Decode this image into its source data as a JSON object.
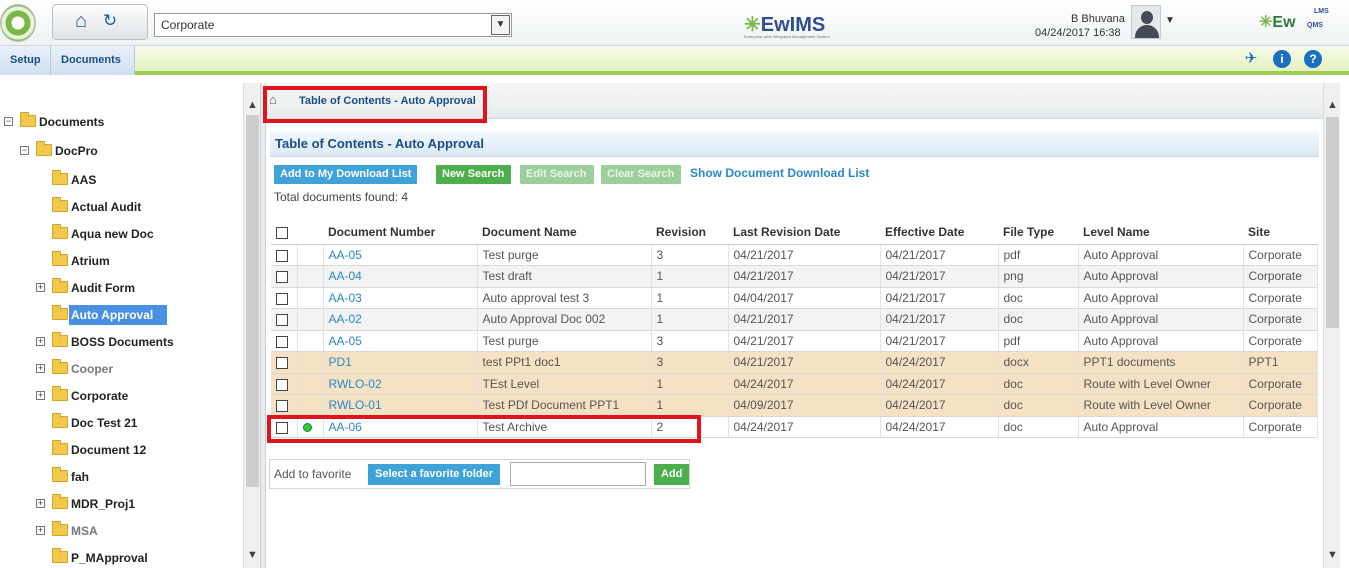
{
  "header": {
    "site_select": "Corporate",
    "brand_center": "EwIMS",
    "brand_center_tag": "Enterprise-wide Integrated Management System",
    "user_name": "B Bhuvana",
    "user_datetime": "04/24/2017 16:38",
    "brand_right": "Ew",
    "brand_right_lms": "LMS",
    "brand_right_qms": "QMS",
    "colors": {
      "accent_green": "#9ccc52",
      "link_blue": "#2a88c9",
      "highlight_red": "#e2141b"
    }
  },
  "menu": {
    "setup": "Setup",
    "documents": "Documents",
    "icons": [
      "pin-icon",
      "info-icon",
      "help-icon"
    ]
  },
  "tree": {
    "root": "Documents",
    "docpro": "DocPro",
    "items": [
      {
        "label": "AAS",
        "expandable": false
      },
      {
        "label": "Actual Audit",
        "expandable": false
      },
      {
        "label": "Aqua new Doc",
        "expandable": false
      },
      {
        "label": "Atrium",
        "expandable": false
      },
      {
        "label": "Audit Form",
        "expandable": true
      },
      {
        "label": "Auto Approval",
        "expandable": false,
        "selected": true
      },
      {
        "label": "BOSS Documents",
        "expandable": true
      },
      {
        "label": "Cooper",
        "expandable": true,
        "grey": true
      },
      {
        "label": "Corporate",
        "expandable": true
      },
      {
        "label": "Doc Test 21",
        "expandable": false
      },
      {
        "label": "Document 12",
        "expandable": false
      },
      {
        "label": "fah",
        "expandable": false
      },
      {
        "label": "MDR_Proj1",
        "expandable": true
      },
      {
        "label": "MSA",
        "expandable": true,
        "grey": true
      },
      {
        "label": "P_MApproval",
        "expandable": false
      }
    ]
  },
  "content": {
    "breadcrumb": "Table of Contents - Auto Approval",
    "panel_title": "Table of Contents - Auto Approval",
    "buttons": {
      "add_download": "Add to My Download List",
      "new_search": "New Search",
      "edit_search": "Edit Search",
      "clear_search": "Clear Search",
      "show_download": "Show Document Download List"
    },
    "total": "Total documents found: 4",
    "columns": [
      "Document Number",
      "Document Name",
      "Revision",
      "Last Revision Date",
      "Effective Date",
      "File Type",
      "Level Name",
      "Site"
    ],
    "rows": [
      {
        "num": "AA-05",
        "name": "Test purge",
        "rev": "3",
        "last": "04/21/2017",
        "eff": "04/21/2017",
        "type": "pdf",
        "level": "Auto Approval",
        "site": "Corporate",
        "style": "odd"
      },
      {
        "num": "AA-04",
        "name": "Test draft",
        "rev": "1",
        "last": "04/21/2017",
        "eff": "04/21/2017",
        "type": "png",
        "level": "Auto Approval",
        "site": "Corporate",
        "style": "even"
      },
      {
        "num": "AA-03",
        "name": "Auto approval test 3",
        "rev": "1",
        "last": "04/04/2017",
        "eff": "04/21/2017",
        "type": "doc",
        "level": "Auto Approval",
        "site": "Corporate",
        "style": "odd"
      },
      {
        "num": "AA-02",
        "name": "Auto Approval Doc 002",
        "rev": "1",
        "last": "04/21/2017",
        "eff": "04/21/2017",
        "type": "doc",
        "level": "Auto Approval",
        "site": "Corporate",
        "style": "even"
      },
      {
        "num": "AA-05",
        "name": "Test purge",
        "rev": "3",
        "last": "04/21/2017",
        "eff": "04/21/2017",
        "type": "pdf",
        "level": "Auto Approval",
        "site": "Corporate",
        "style": "odd"
      },
      {
        "num": "PD1",
        "name": "test PPt1 doc1",
        "rev": "3",
        "last": "04/21/2017",
        "eff": "04/24/2017",
        "type": "docx",
        "level": "PPT1 documents",
        "site": "PPT1",
        "style": "tan"
      },
      {
        "num": "RWLO-02",
        "name": "TEst Level",
        "rev": "1",
        "last": "04/24/2017",
        "eff": "04/24/2017",
        "type": "doc",
        "level": "Route with Level Owner",
        "site": "Corporate",
        "style": "tan"
      },
      {
        "num": "RWLO-01",
        "name": "Test PDf Document PPT1",
        "rev": "1",
        "last": "04/09/2017",
        "eff": "04/24/2017",
        "type": "doc",
        "level": "Route with Level Owner",
        "site": "Corporate",
        "style": "tan"
      },
      {
        "num": "AA-06",
        "name": "Test Archive",
        "rev": "2",
        "last": "04/24/2017",
        "eff": "04/24/2017",
        "type": "doc",
        "level": "Auto Approval",
        "site": "Corporate",
        "style": "odd",
        "status_dot": true
      }
    ],
    "favorite": {
      "label": "Add to favorite",
      "select_btn": "Select a favorite folder",
      "input_value": "",
      "add_btn": "Add"
    }
  }
}
